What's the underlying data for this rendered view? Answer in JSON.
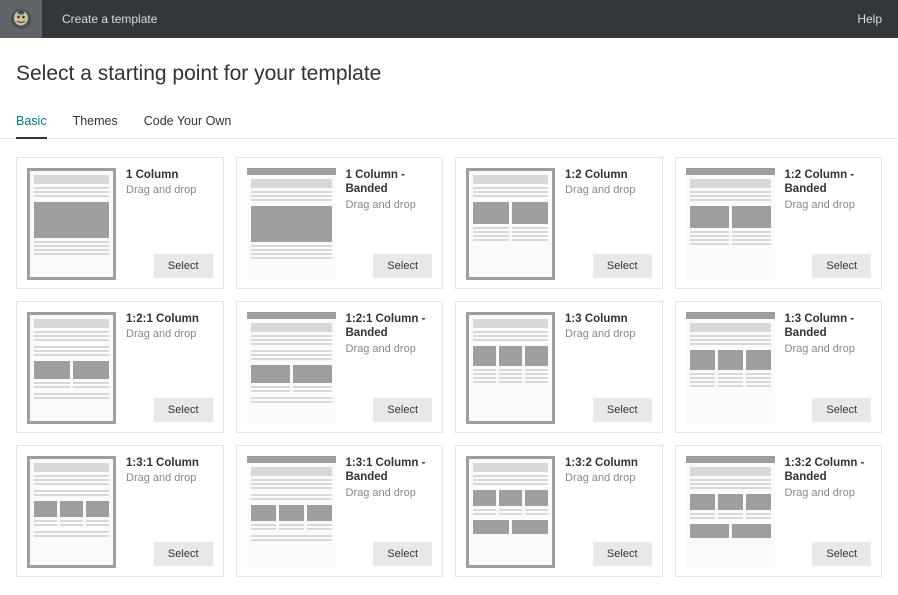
{
  "header": {
    "breadcrumb": "Create a template",
    "help": "Help"
  },
  "page_title": "Select a starting point for your template",
  "tabs": [
    {
      "id": "basic",
      "label": "Basic",
      "active": true
    },
    {
      "id": "themes",
      "label": "Themes",
      "active": false
    },
    {
      "id": "code",
      "label": "Code Your Own",
      "active": false
    }
  ],
  "select_label": "Select",
  "templates": [
    {
      "title": "1 Column",
      "subtitle": "Drag and drop",
      "layout": "1col",
      "banded": false
    },
    {
      "title": "1 Column - Banded",
      "subtitle": "Drag and drop",
      "layout": "1col",
      "banded": true
    },
    {
      "title": "1:2 Column",
      "subtitle": "Drag and drop",
      "layout": "12col",
      "banded": false
    },
    {
      "title": "1:2 Column - Banded",
      "subtitle": "Drag and drop",
      "layout": "12col",
      "banded": true
    },
    {
      "title": "1:2:1 Column",
      "subtitle": "Drag and drop",
      "layout": "121col",
      "banded": false
    },
    {
      "title": "1:2:1 Column - Banded",
      "subtitle": "Drag and drop",
      "layout": "121col",
      "banded": true
    },
    {
      "title": "1:3 Column",
      "subtitle": "Drag and drop",
      "layout": "13col",
      "banded": false
    },
    {
      "title": "1:3 Column - Banded",
      "subtitle": "Drag and drop",
      "layout": "13col",
      "banded": true
    },
    {
      "title": "1:3:1 Column",
      "subtitle": "Drag and drop",
      "layout": "131col",
      "banded": false
    },
    {
      "title": "1:3:1 Column - Banded",
      "subtitle": "Drag and drop",
      "layout": "131col",
      "banded": true
    },
    {
      "title": "1:3:2 Column",
      "subtitle": "Drag and drop",
      "layout": "132col",
      "banded": false
    },
    {
      "title": "1:3:2 Column - Banded",
      "subtitle": "Drag and drop",
      "layout": "132col",
      "banded": true
    }
  ]
}
